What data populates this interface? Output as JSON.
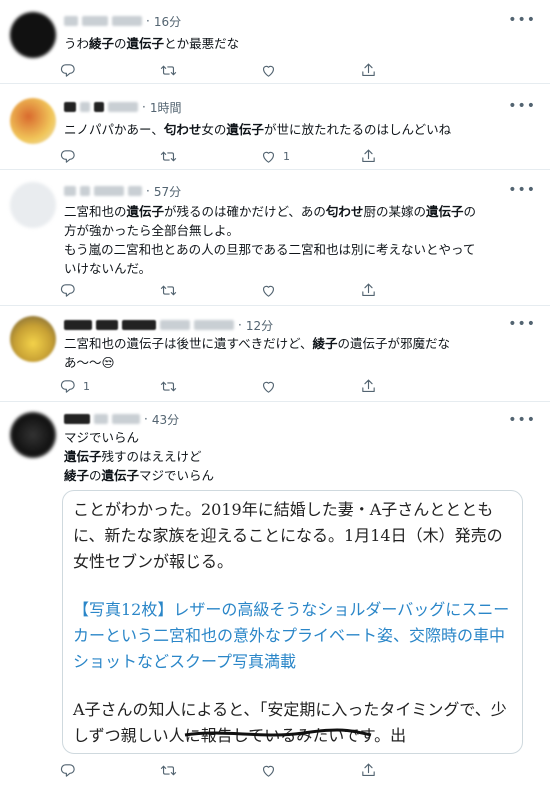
{
  "tweets": [
    {
      "time": "16分",
      "text_parts": [
        {
          "t": "うわ"
        },
        {
          "t": "綾子",
          "b": true
        },
        {
          "t": "の"
        },
        {
          "t": "遺伝子",
          "b": true
        },
        {
          "t": "とか最悪だな"
        }
      ],
      "reply_count": "",
      "like_count": ""
    },
    {
      "time": "1時間",
      "text_parts": [
        {
          "t": "ニノパパかあー、"
        },
        {
          "t": "匂わせ",
          "b": true
        },
        {
          "t": "女の"
        },
        {
          "t": "遺伝子",
          "b": true
        },
        {
          "t": "が世に放たれたるのはしんどいね"
        }
      ],
      "reply_count": "",
      "like_count": "1"
    },
    {
      "time": "57分",
      "text_parts": [
        {
          "t": "二宮和也の"
        },
        {
          "t": "遺伝子",
          "b": true
        },
        {
          "t": "が残るのは確かだけど、あの"
        },
        {
          "t": "匂わせ",
          "b": true
        },
        {
          "t": "厨の某嫁の"
        },
        {
          "t": "遺伝子",
          "b": true
        },
        {
          "t": "の\n方が強かったら全部台無しよ。\nもう嵐の二宮和也とあの人の旦那である二宮和也は別に考えないとやって\nいけないんだ。"
        }
      ],
      "reply_count": "",
      "like_count": ""
    },
    {
      "time": "12分",
      "text_parts": [
        {
          "t": "二宮和也の遺伝子は後世に遺すべきだけど、"
        },
        {
          "t": "綾子",
          "b": true
        },
        {
          "t": "の遺伝子が邪魔だな\nあ～～😒"
        }
      ],
      "reply_count": "1",
      "like_count": ""
    },
    {
      "time": "43分",
      "text_parts": [
        {
          "t": "マジでいらん\n"
        },
        {
          "t": "遺伝子",
          "b": true
        },
        {
          "t": "残すのはええけど\n"
        },
        {
          "t": "綾子",
          "b": true
        },
        {
          "t": "の"
        },
        {
          "t": "遺伝子",
          "b": true
        },
        {
          "t": "マジでいらん"
        }
      ],
      "reply_count": "",
      "like_count": ""
    }
  ],
  "article": {
    "para1": "ことがわかった。2019年に結婚した妻・A子さんととともに、新たな家族を迎えることになる。1月14日（木）発売の女性セブンが報じる。",
    "para2": "【写真12枚】レザーの高級そうなショルダーバッグにスニーカーという二宮和也の意外なプライベート姿、交際時の車中ショットなどスクープ写真満載",
    "para3": "A子さんの知人によると、「安定期に入ったタイミングで、少しずつ親しい人に報告しているみたいです。出"
  },
  "icons": [
    "more-icon",
    "reply-icon",
    "retweet-icon",
    "like-icon",
    "share-icon"
  ],
  "colors": {
    "icon": "#536471",
    "link": "#2a86c8",
    "border": "#e6ecf0"
  }
}
